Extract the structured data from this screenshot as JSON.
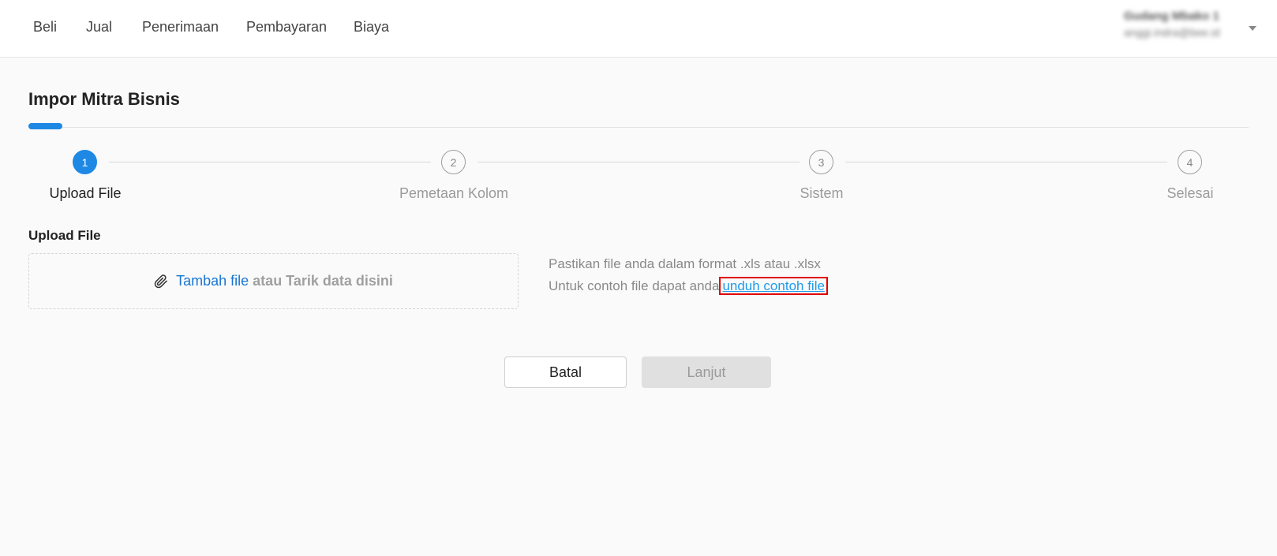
{
  "nav": {
    "items": [
      "Beli",
      "Jual",
      "Penerimaan",
      "Pembayaran",
      "Biaya"
    ],
    "account_name": "Gudang Mbako 1",
    "account_email": "anggi.indra@bee.id"
  },
  "page": {
    "title": "Impor Mitra Bisnis"
  },
  "stepper": {
    "steps": [
      {
        "number": "1",
        "label": "Upload File"
      },
      {
        "number": "2",
        "label": "Pemetaan Kolom"
      },
      {
        "number": "3",
        "label": "Sistem"
      },
      {
        "number": "4",
        "label": "Selesai"
      }
    ],
    "active_index": 0
  },
  "upload": {
    "section_title": "Upload File",
    "add_file_label": "Tambah file",
    "drag_label": "atau Tarik data disini",
    "info_line1": "Pastikan file anda dalam format .xls atau .xlsx",
    "info_line2_prefix": "Untuk contoh file dapat anda",
    "download_link": "unduh contoh file"
  },
  "actions": {
    "cancel_label": "Batal",
    "next_label": "Lanjut"
  },
  "colors": {
    "accent": "#1e88e5",
    "link": "#1976d2",
    "highlight_border": "#e00000"
  },
  "icons": {
    "attach": "paperclip-icon",
    "account_menu": "caret-down-icon"
  }
}
